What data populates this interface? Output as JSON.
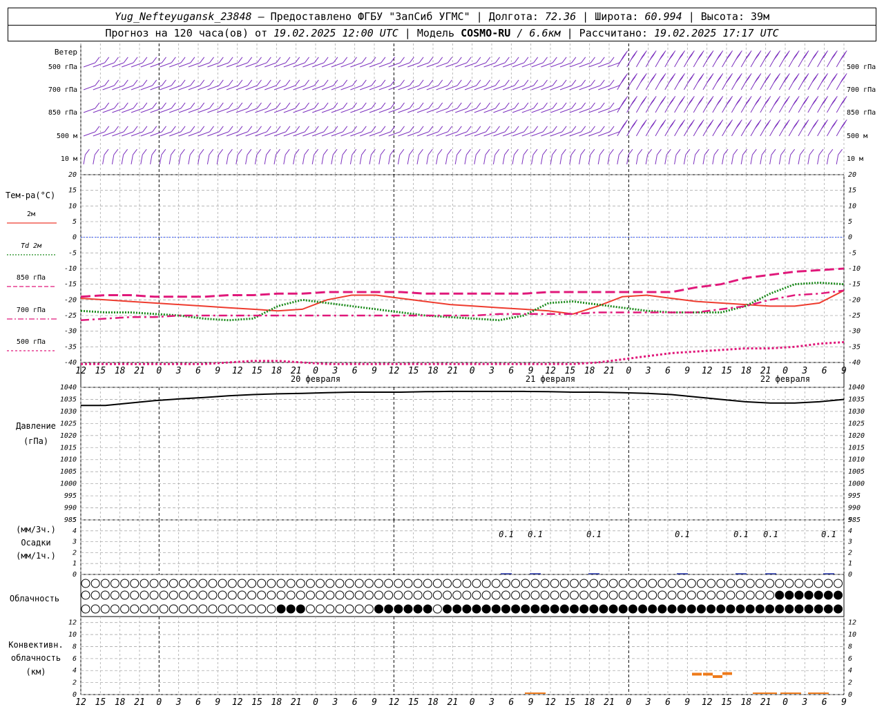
{
  "header": {
    "station": "Yug_Nefteyugansk_23848",
    "provider": " – Предоставлено ФГБУ \"ЗапСиб УГМС\" | Долгота: ",
    "lon": "72.36",
    "lat_label": " | Широта: ",
    "lat": "60.994",
    "alt_label": " | Высота: ",
    "alt": "39м",
    "forecast_label": "Прогноз на 120 часа(ов) от ",
    "forecast_time": "19.02.2025 12:00 UTC",
    "model_label": " | Модель ",
    "model": "COSMO-RU",
    "resolution": " / 6.6км",
    "calc_label": " | Рассчитано: ",
    "calc_time": "19.02.2025 17:17 UTC"
  },
  "labels": {
    "wind": "Ветер",
    "wind_levels": [
      "500 гПа",
      "700 гПа",
      "850 гПа",
      "500 м",
      "10 м"
    ],
    "temp_title": "Тем-ра(°C)",
    "temp_legend": [
      {
        "label": "2м",
        "color": "#ee3b2e",
        "style": "solid"
      },
      {
        "label": "Td 2м",
        "color": "#1a8a1a",
        "style": "dotted"
      },
      {
        "label": "850 гПа",
        "color": "#e0187a",
        "style": "dash"
      },
      {
        "label": "700 гПа",
        "color": "#e0187a",
        "style": "dashdot"
      },
      {
        "label": "500 гПа",
        "color": "#e0187a",
        "style": "dot"
      }
    ],
    "pressure": "Давление",
    "pressure_unit": "(гПа)",
    "precip_top": "(мм/3ч.)",
    "precip": "Осадки",
    "precip_unit": "(мм/1ч.)",
    "cloud": "Облачность",
    "conv1": "Конвективн.",
    "conv2": "облачность",
    "conv3": "(км)",
    "dates": [
      "20 февраля",
      "21 февраля",
      "22 февраля"
    ]
  },
  "chart_data": {
    "type": "meteogram",
    "x_hours": [
      0,
      6,
      12,
      18,
      24,
      30,
      36,
      42,
      48,
      54,
      60,
      66,
      72,
      78,
      84,
      90,
      96,
      102,
      108,
      114,
      120
    ],
    "x_tick_labels": [
      "12",
      "15",
      "18",
      "21",
      "0",
      "3",
      "6",
      "9",
      "12",
      "15",
      "18",
      "21",
      "0",
      "3",
      "6",
      "9",
      "12",
      "15",
      "18",
      "21",
      "0",
      "3",
      "6",
      "9",
      "12",
      "15",
      "18",
      "21",
      "0",
      "3",
      "6",
      "9",
      "12",
      "15",
      "18",
      "21",
      "0",
      "3",
      "6",
      "9",
      "12",
      "15",
      "18"
    ],
    "temperature": {
      "yticks": [
        20,
        15,
        10,
        5,
        0,
        -5,
        -10,
        -15,
        -20,
        -25,
        -30,
        -35,
        -40
      ],
      "ylim": [
        -40,
        20
      ],
      "series": [
        {
          "name": "2м",
          "hours": [
            0,
            6,
            12,
            18,
            24,
            30,
            36,
            42,
            48,
            54,
            60,
            66,
            72,
            78,
            84,
            90,
            96,
            102,
            108,
            114,
            120,
            126,
            132,
            138,
            144,
            150,
            156,
            162,
            168,
            174,
            180,
            186
          ],
          "values": [
            -19.5,
            -20,
            -20.5,
            -21,
            -21.5,
            -22,
            -22.5,
            -23,
            -23.5,
            -23,
            -20,
            -18.5,
            -18.5,
            -19.5,
            -20.5,
            -21.5,
            -22,
            -22.5,
            -23,
            -23.5,
            -24.5,
            -22,
            -19,
            -18.5,
            -19.5,
            -20.5,
            -21,
            -21.5,
            -22,
            -22,
            -21,
            -17
          ],
          "color": "#ee3b2e"
        },
        {
          "name": "Td 2м",
          "values": [
            -23.5,
            -24,
            -24,
            -24.5,
            -25,
            -26,
            -26.5,
            -26,
            -22,
            -20,
            -21,
            -22,
            -23,
            -24,
            -25,
            -25.5,
            -26,
            -26.5,
            -25,
            -21,
            -20.5,
            -21.5,
            -22.5,
            -23.5,
            -24,
            -24,
            -24,
            -22,
            -18,
            -15,
            -14.5,
            -15
          ],
          "color": "#1a8a1a"
        },
        {
          "name": "850 гПа",
          "values": [
            -19,
            -18.5,
            -18.5,
            -19,
            -19,
            -19,
            -18.5,
            -18.5,
            -18,
            -18,
            -17.5,
            -17.5,
            -17.5,
            -17.5,
            -18,
            -18,
            -18,
            -18,
            -18,
            -17.5,
            -17.5,
            -17.5,
            -17.5,
            -17.5,
            -17.5,
            -16,
            -15,
            -13,
            -12,
            -11,
            -10.5,
            -10
          ],
          "color": "#e0187a"
        },
        {
          "name": "700 гПа",
          "values": [
            -26.5,
            -26,
            -25.5,
            -25.5,
            -25,
            -25,
            -25,
            -25,
            -25,
            -25,
            -25,
            -25,
            -25,
            -25,
            -25,
            -25,
            -25,
            -24.5,
            -24.5,
            -24.5,
            -24.5,
            -24,
            -24,
            -24,
            -24,
            -24,
            -23,
            -22,
            -20,
            -18.5,
            -18,
            -17
          ],
          "color": "#e0187a"
        },
        {
          "name": "500 гПа",
          "values": [
            -41,
            -41,
            -41,
            -41,
            -41,
            -41,
            -40,
            -39.5,
            -39.5,
            -40,
            -41,
            -41,
            -41,
            -41,
            -41,
            -41,
            -41,
            -41,
            -41,
            -41,
            -41,
            -40,
            -39,
            -38,
            -37,
            -36.5,
            -36,
            -35.5,
            -35.5,
            -35,
            -34,
            -33.5
          ],
          "color": "#e0187a"
        }
      ]
    },
    "pressure": {
      "yticks": [
        1040,
        1035,
        1030,
        1025,
        1020,
        1015,
        1010,
        1005,
        1000,
        995,
        990,
        985
      ],
      "ylim": [
        985,
        1040
      ],
      "values": [
        1032.5,
        1032.5,
        1033.5,
        1034.5,
        1035.2,
        1035.8,
        1036.5,
        1037,
        1037.3,
        1037.5,
        1037.8,
        1038,
        1038,
        1038,
        1038.2,
        1038.3,
        1038.3,
        1038.3,
        1038.3,
        1038.2,
        1038,
        1038,
        1037.8,
        1037.5,
        1037,
        1036,
        1035,
        1034,
        1033.5,
        1033.5,
        1034,
        1035
      ]
    },
    "precipitation": {
      "yticks": [
        5,
        4,
        3,
        2,
        1,
        0
      ],
      "labels": [
        {
          "x": 42,
          "text": "0.1"
        },
        {
          "x": 45,
          "text": "0.1"
        },
        {
          "x": 51,
          "text": "0.1"
        },
        {
          "x": 60,
          "text": "0.1"
        },
        {
          "x": 66,
          "text": "0.1"
        },
        {
          "x": 69,
          "text": "0.1"
        },
        {
          "x": 75,
          "text": "0.1"
        }
      ]
    },
    "convective_cloud": {
      "yticks": [
        12,
        10,
        8,
        6,
        4,
        2,
        0
      ],
      "bars": [
        {
          "x": 62,
          "top": 3.4
        },
        {
          "x": 63,
          "top": 3.4
        },
        {
          "x": 64,
          "top": 3.0
        },
        {
          "x": 65,
          "top": 3.5
        }
      ]
    }
  }
}
